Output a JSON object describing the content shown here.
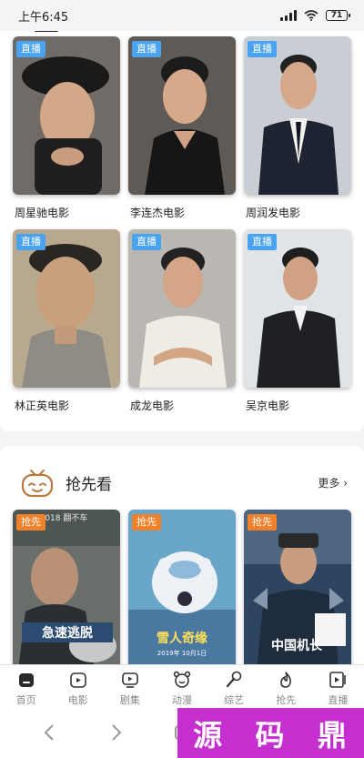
{
  "status": {
    "time": "上午6:45",
    "battery": "71"
  },
  "live_badge": "直播",
  "preview_badge": "抢先",
  "live_grid": [
    {
      "title": "周星驰电影",
      "bg": "#6f6a66"
    },
    {
      "title": "李连杰电影",
      "bg": "#5e5955"
    },
    {
      "title": "周润发电影",
      "bg": "#c7cdd3"
    },
    {
      "title": "林正英电影",
      "bg": "#b7a78f"
    },
    {
      "title": "成龙电影",
      "bg": "#b9b6b2"
    },
    {
      "title": "吴京电影",
      "bg": "#dfe3e6"
    }
  ],
  "section": {
    "title": "抢先看",
    "more": "更多 ›"
  },
  "preview_posters": [
    {
      "bg": "#6a6f6b",
      "logo": "急速逃脱",
      "caption": "2018 翻不车"
    },
    {
      "bg": "#6ea8c8",
      "logo": "雪人奇缘",
      "caption": "2019年 10月1日"
    },
    {
      "bg": "#2f4560",
      "logo": "中国机长",
      "caption": ""
    }
  ],
  "tabs": [
    {
      "label": "首页",
      "icon": "home-icon"
    },
    {
      "label": "电影",
      "icon": "film-icon"
    },
    {
      "label": "剧集",
      "icon": "tv-icon"
    },
    {
      "label": "动漫",
      "icon": "anime-icon"
    },
    {
      "label": "综艺",
      "icon": "mic-icon"
    },
    {
      "label": "抢先",
      "icon": "flame-icon"
    },
    {
      "label": "直播",
      "icon": "live-icon"
    }
  ],
  "watermark": [
    "源",
    "码",
    "鼎"
  ],
  "colors": {
    "live_badge": "#4aa3f0",
    "preview_badge": "#f0812b",
    "watermark": "#c62fcf"
  }
}
